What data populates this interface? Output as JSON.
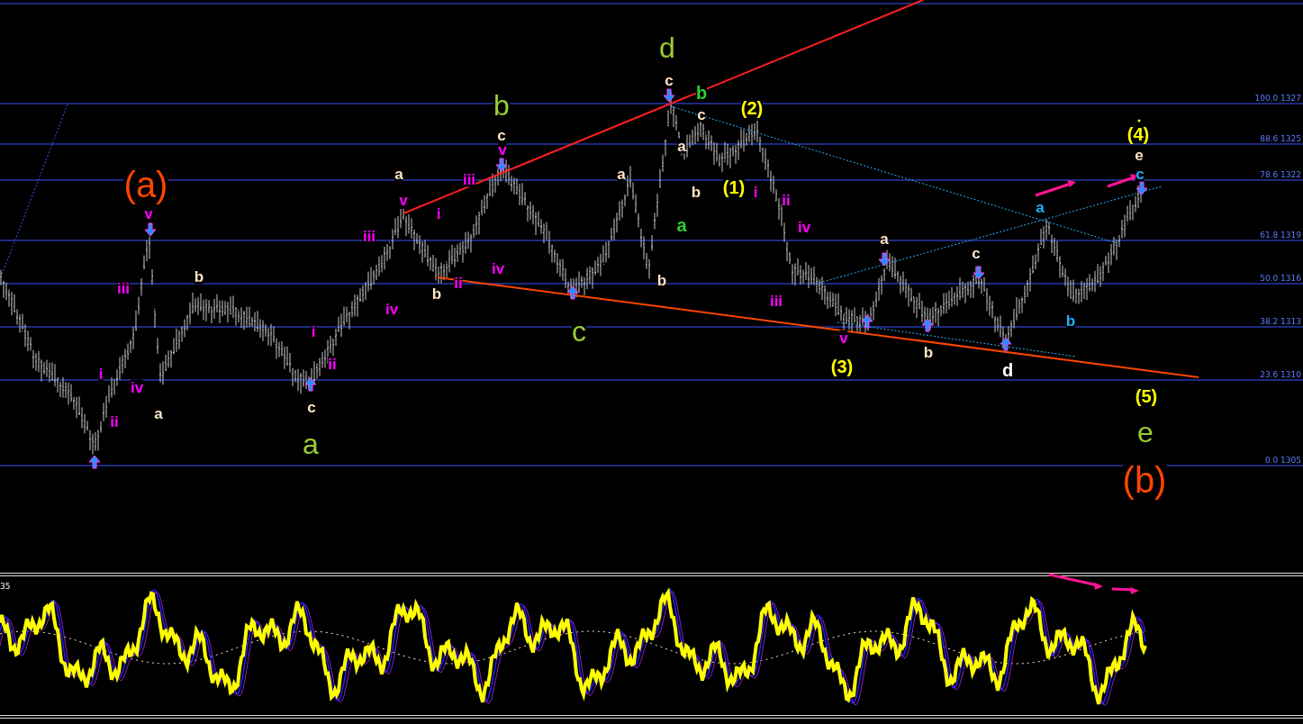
{
  "fib_levels": [
    {
      "label": "100.0 1327"
    },
    {
      "label": "88.6 1325"
    },
    {
      "label": "78.6 1322"
    },
    {
      "label": "61.8 1319"
    },
    {
      "label": "50.0 1316"
    },
    {
      "label": "38.2 1313"
    },
    {
      "label": "23.6 1310"
    },
    {
      "label": "0.0 1305"
    }
  ],
  "wave_labels": [
    {
      "text": "(a)",
      "color": "#ff4500",
      "kind": "cycle"
    },
    {
      "text": "v",
      "color": "#ff00ff",
      "kind": "minor"
    },
    {
      "text": "iii",
      "color": "#ff00ff",
      "kind": "minor"
    },
    {
      "text": "i",
      "color": "#ff00ff",
      "kind": "minor"
    },
    {
      "text": "iv",
      "color": "#ff00ff",
      "kind": "minor"
    },
    {
      "text": "ii",
      "color": "#ff00ff",
      "kind": "minor"
    },
    {
      "text": "b",
      "color": "#ffe4c4",
      "kind": "minor"
    },
    {
      "text": "a",
      "color": "#ffe4c4",
      "kind": "minor"
    },
    {
      "text": "i",
      "color": "#ff00ff",
      "kind": "minor"
    },
    {
      "text": "ii",
      "color": "#ff00ff",
      "kind": "minor"
    },
    {
      "text": "c",
      "color": "#ffe4c4",
      "kind": "minor"
    },
    {
      "text": "a",
      "color": "#9acd32",
      "kind": "primary"
    },
    {
      "text": "iii",
      "color": "#ff00ff",
      "kind": "minor"
    },
    {
      "text": "a",
      "color": "#ffe4c4",
      "kind": "minor"
    },
    {
      "text": "v",
      "color": "#ff00ff",
      "kind": "minor"
    },
    {
      "text": "iv",
      "color": "#ff00ff",
      "kind": "minor"
    },
    {
      "text": "i",
      "color": "#ff00ff",
      "kind": "minor"
    },
    {
      "text": "iii",
      "color": "#ff00ff",
      "kind": "minor"
    },
    {
      "text": "b",
      "color": "#ffe4c4",
      "kind": "minor"
    },
    {
      "text": "ii",
      "color": "#ff00ff",
      "kind": "minor"
    },
    {
      "text": "b",
      "color": "#9acd32",
      "kind": "primary"
    },
    {
      "text": "c",
      "color": "#ffe4c4",
      "kind": "minor"
    },
    {
      "text": "v",
      "color": "#ff00ff",
      "kind": "minor"
    },
    {
      "text": "iv",
      "color": "#ff00ff",
      "kind": "minor"
    },
    {
      "text": "a",
      "color": "#ffe4c4",
      "kind": "minor"
    },
    {
      "text": "c",
      "color": "#9acd32",
      "kind": "primary"
    },
    {
      "text": "d",
      "color": "#9acd32",
      "kind": "primary"
    },
    {
      "text": "c",
      "color": "#ffe4c4",
      "kind": "minor"
    },
    {
      "text": "b",
      "color": "#ffe4c4",
      "kind": "minor"
    },
    {
      "text": "b",
      "color": "#32cd32",
      "kind": "medium"
    },
    {
      "text": "c",
      "color": "#ffe4c4",
      "kind": "minor"
    },
    {
      "text": "a",
      "color": "#ffe4c4",
      "kind": "minor"
    },
    {
      "text": "b",
      "color": "#ffe4c4",
      "kind": "minor"
    },
    {
      "text": "a",
      "color": "#32cd32",
      "kind": "medium"
    },
    {
      "text": "(2)",
      "color": "#ffff00",
      "kind": "medium"
    },
    {
      "text": "(1)",
      "color": "#ffff00",
      "kind": "medium"
    },
    {
      "text": "i",
      "color": "#ff00ff",
      "kind": "minor"
    },
    {
      "text": "ii",
      "color": "#ff00ff",
      "kind": "minor"
    },
    {
      "text": "iv",
      "color": "#ff00ff",
      "kind": "minor"
    },
    {
      "text": "iii",
      "color": "#ff00ff",
      "kind": "minor"
    },
    {
      "text": "v",
      "color": "#ff00ff",
      "kind": "minor"
    },
    {
      "text": "(3)",
      "color": "#ffff00",
      "kind": "medium"
    },
    {
      "text": "a",
      "color": "#ffe4c4",
      "kind": "minor"
    },
    {
      "text": "b",
      "color": "#ffe4c4",
      "kind": "minor"
    },
    {
      "text": "c",
      "color": "#ffe4c4",
      "kind": "minor"
    },
    {
      "text": "d",
      "color": "#ffffff",
      "kind": "medium"
    },
    {
      "text": "a",
      "color": "#1eb4ff",
      "kind": "minor"
    },
    {
      "text": "b",
      "color": "#1eb4ff",
      "kind": "minor"
    },
    {
      "text": "(4)",
      "color": "#ffff00",
      "kind": "medium"
    },
    {
      "text": "e",
      "color": "#ffe4c4",
      "kind": "minor"
    },
    {
      "text": "c",
      "color": "#1eb4ff",
      "kind": "minor"
    },
    {
      "text": "(5)",
      "color": "#ffff00",
      "kind": "medium"
    },
    {
      "text": "e",
      "color": "#9acd32",
      "kind": "primary"
    },
    {
      "text": "(b)",
      "color": "#ff4500",
      "kind": "cycle"
    }
  ],
  "indicator": {
    "label": "35"
  }
}
